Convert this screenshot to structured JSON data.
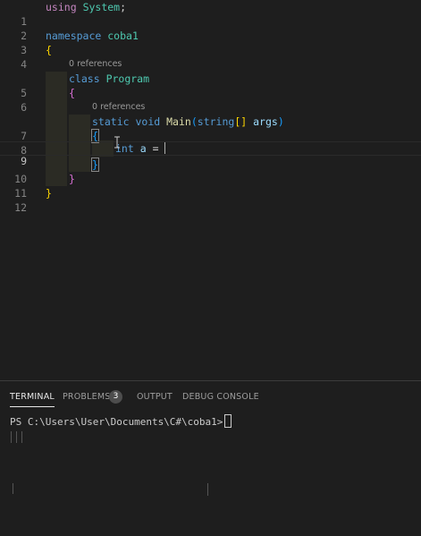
{
  "editor": {
    "line_numbers": [
      "1",
      "2",
      "3",
      "4",
      "5",
      "6",
      "7",
      "8",
      "9",
      "10",
      "11",
      "12"
    ],
    "code": {
      "l1_kw": "using",
      "l1_ns": "System",
      "l1_semi": ";",
      "l3_kw": "namespace",
      "l3_name": "coba1",
      "l4_brace": "{",
      "lens1": "0 references",
      "l5_kw": "class",
      "l5_name": "Program",
      "l6_brace": "{",
      "lens2": "0 references",
      "l7_static": "static",
      "l7_void": "void",
      "l7_main": "Main",
      "l7_open": "(",
      "l7_string": "string",
      "l7_arr": "[]",
      "l7_args": "args",
      "l7_close": ")",
      "l8_brace": "{",
      "l9_int": "int",
      "l9_a": "a",
      "l9_eq": "=",
      "l10_brace": "}",
      "l11_brace": "}",
      "l12_brace": "}"
    }
  },
  "panel": {
    "tabs": {
      "terminal": "TERMINAL",
      "problems": "PROBLEMS",
      "problems_count": "3",
      "output": "OUTPUT",
      "debug": "DEBUG CONSOLE"
    },
    "terminal_prompt": "PS C:\\Users\\User\\Documents\\C#\\coba1>"
  }
}
